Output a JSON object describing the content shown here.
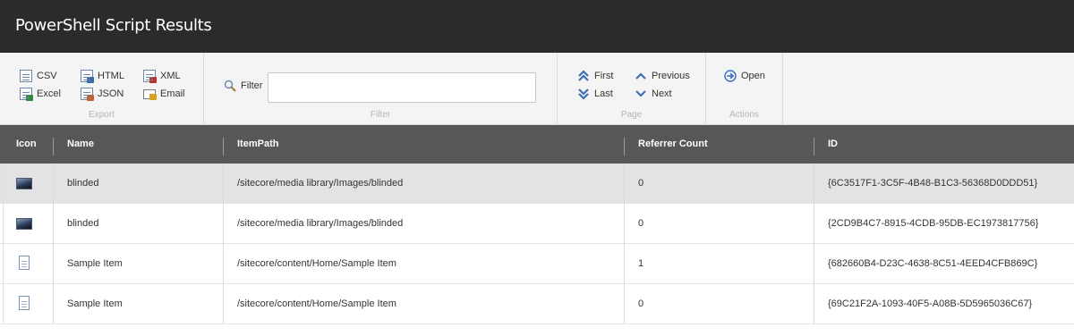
{
  "window": {
    "title": "PowerShell Script Results"
  },
  "ribbon": {
    "export": {
      "label": "Export",
      "csv": "CSV",
      "excel": "Excel",
      "html": "HTML",
      "json": "JSON",
      "xml": "XML",
      "email": "Email"
    },
    "filter": {
      "label": "Filter",
      "button": "Filter",
      "value": "",
      "placeholder": ""
    },
    "page": {
      "label": "Page",
      "first": "First",
      "last": "Last",
      "previous": "Previous",
      "next": "Next"
    },
    "actions": {
      "label": "Actions",
      "open": "Open"
    }
  },
  "table": {
    "columns": [
      "Icon",
      "Name",
      "ItemPath",
      "Referrer Count",
      "ID"
    ],
    "rows": [
      {
        "icon": "media-image-icon",
        "name": "blinded",
        "path": "/sitecore/media library/Images/blinded",
        "count": "0",
        "id": "{6C3517F1-3C5F-4B48-B1C3-56368D0DDD51}"
      },
      {
        "icon": "media-image-icon",
        "name": "blinded",
        "path": "/sitecore/media library/Images/blinded",
        "count": "0",
        "id": "{2CD9B4C7-8915-4CDB-95DB-EC1973817756}"
      },
      {
        "icon": "document-icon",
        "name": "Sample Item",
        "path": "/sitecore/content/Home/Sample Item",
        "count": "1",
        "id": "{682660B4-D23C-4638-8C51-4EED4CFB869C}"
      },
      {
        "icon": "document-icon",
        "name": "Sample Item",
        "path": "/sitecore/content/Home/Sample Item",
        "count": "0",
        "id": "{69C21F2A-1093-40F5-A08B-5D5965036C67}"
      }
    ]
  }
}
